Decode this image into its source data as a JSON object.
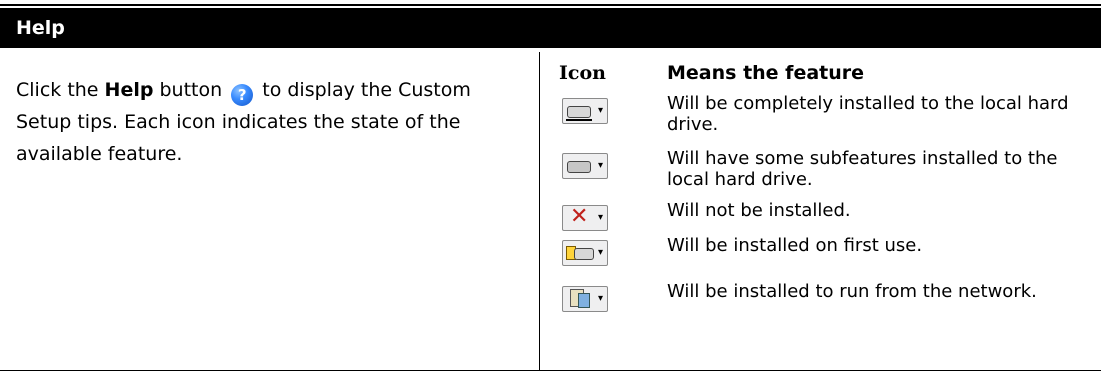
{
  "header": {
    "title": "Help"
  },
  "left": {
    "text_before": "Click the ",
    "bold_word": "Help",
    "text_after_button": " button",
    "text_after_icon": " to display the Custom Setup tips. Each icon indicates the state of the available feature.",
    "help_icon_glyph": "?"
  },
  "table": {
    "col_icon": "Icon",
    "col_means": "Means the feature",
    "rows": [
      {
        "icon": "hard-drive-icon",
        "text": "Will be completely installed to the local hard drive."
      },
      {
        "icon": "hard-drive-partial-icon",
        "text": "Will have some subfeatures installed to the local hard drive."
      },
      {
        "icon": "not-installed-icon",
        "text": "Will not be installed."
      },
      {
        "icon": "install-on-first-use-icon",
        "text": "Will be installed on first use."
      },
      {
        "icon": "network-install-icon",
        "text": "Will be installed to run from the network."
      }
    ],
    "dropdown_glyph": "▾",
    "x_glyph": "✕"
  }
}
